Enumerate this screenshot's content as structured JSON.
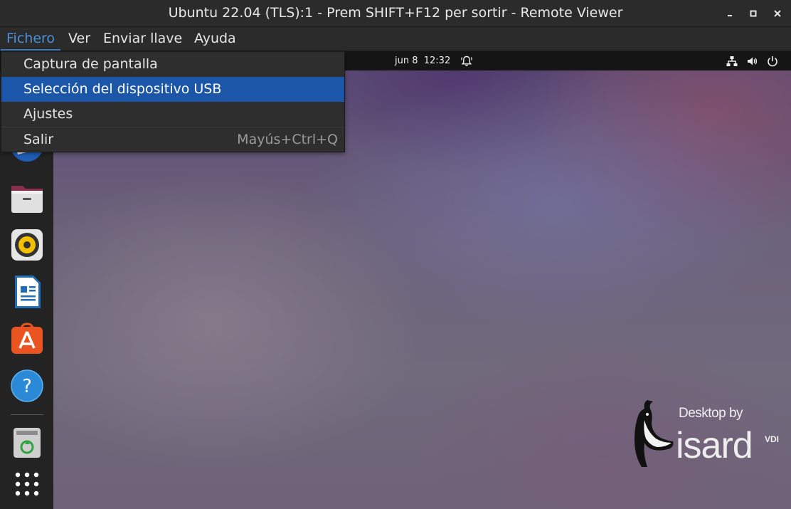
{
  "window": {
    "title": "Ubuntu 22.04 (TLS):1 - Prem SHIFT+F12 per sortir - Remote Viewer",
    "controls": [
      "minimize-icon",
      "maximize-icon",
      "close-icon"
    ]
  },
  "menubar": {
    "items": [
      {
        "label": "Fichero",
        "active": true
      },
      {
        "label": "Ver"
      },
      {
        "label": "Enviar llave"
      },
      {
        "label": "Ayuda"
      }
    ]
  },
  "dropdown": {
    "items": [
      {
        "label": "Captura de pantalla"
      },
      {
        "label": "Selección del dispositivo USB",
        "selected": true
      },
      {
        "label": "Ajustes"
      },
      {
        "label": "Salir",
        "shortcut": "Mayús+Ctrl+Q"
      }
    ],
    "selected_color": "#1c56a8"
  },
  "remote": {
    "topbar": {
      "clock": "jun 8  12:32",
      "icons": [
        "bell-icon",
        "network-icon",
        "volume-icon",
        "power-icon"
      ]
    },
    "dock": {
      "apps": [
        "thunderbird-icon",
        "files-icon",
        "rhythmbox-icon",
        "libreoffice-writer-icon",
        "app-center-icon",
        "help-icon",
        "trash-icon",
        "show-apps-icon"
      ]
    },
    "branding": {
      "by": "Desktop by",
      "name": "isard",
      "suffix": "VDI"
    }
  },
  "colors": {
    "accent": "#4a90d9",
    "titlebar": "#2b2b2b"
  }
}
